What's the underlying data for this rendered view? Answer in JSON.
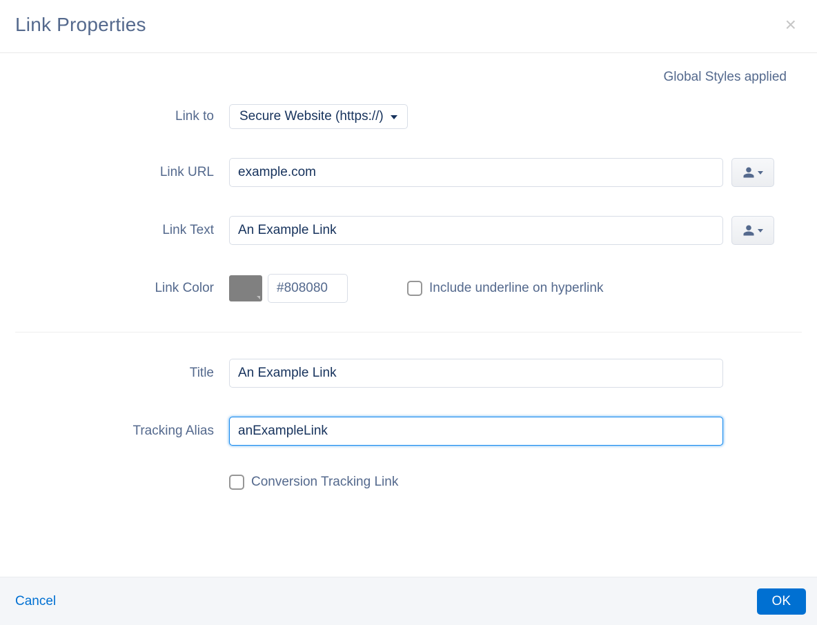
{
  "dialog": {
    "title": "Link Properties",
    "styles_applied": "Global Styles applied"
  },
  "labels": {
    "link_to": "Link to",
    "link_url": "Link URL",
    "link_text": "Link Text",
    "link_color": "Link Color",
    "include_underline": "Include underline on hyperlink",
    "title": "Title",
    "tracking_alias": "Tracking Alias",
    "conversion_tracking": "Conversion Tracking Link"
  },
  "values": {
    "link_to": "Secure Website (https://)",
    "link_url": "example.com",
    "link_text": "An Example Link",
    "link_color": "#808080",
    "title": "An Example Link",
    "tracking_alias": "anExampleLink"
  },
  "footer": {
    "cancel": "Cancel",
    "ok": "OK"
  }
}
